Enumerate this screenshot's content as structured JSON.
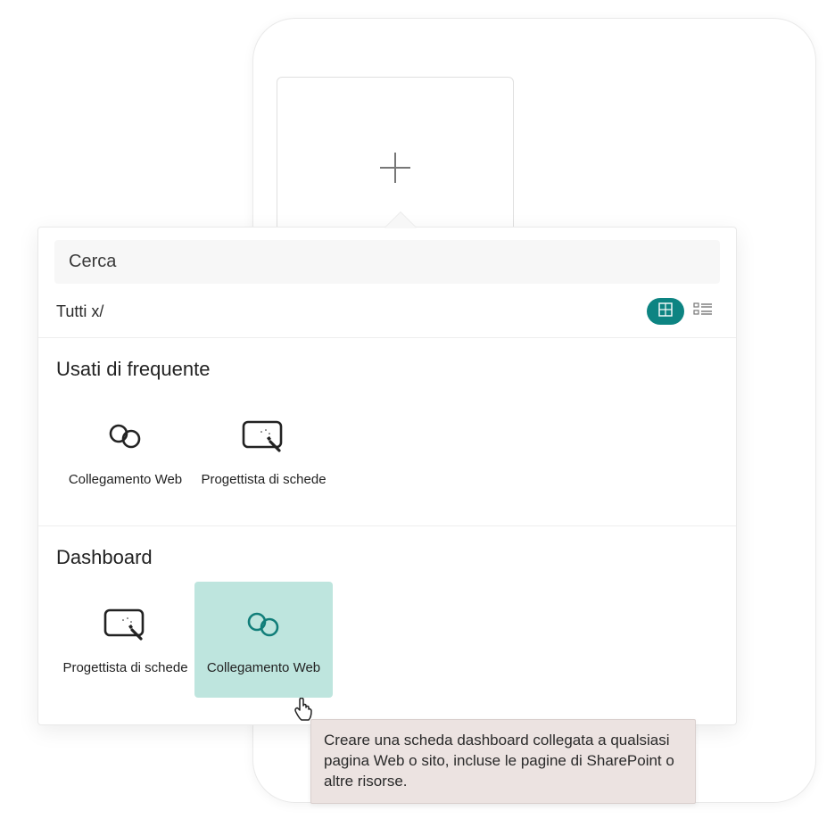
{
  "search": {
    "placeholder": "Cerca"
  },
  "filter": {
    "label": "Tutti x/"
  },
  "sections": {
    "frequent": {
      "title": "Usati di frequente",
      "items": [
        {
          "label": "Collegamento Web",
          "icon": "link-icon"
        },
        {
          "label": "Progettista di schede",
          "icon": "card-designer-icon"
        }
      ]
    },
    "dashboard": {
      "title": "Dashboard",
      "items": [
        {
          "label": "Progettista di schede",
          "icon": "card-designer-icon"
        },
        {
          "label": "Collegamento Web",
          "icon": "link-icon"
        }
      ]
    }
  },
  "tooltip": {
    "text": "Creare una scheda dashboard collegata a qualsiasi pagina Web o sito, incluse le pagine di SharePoint o altre risorse."
  }
}
